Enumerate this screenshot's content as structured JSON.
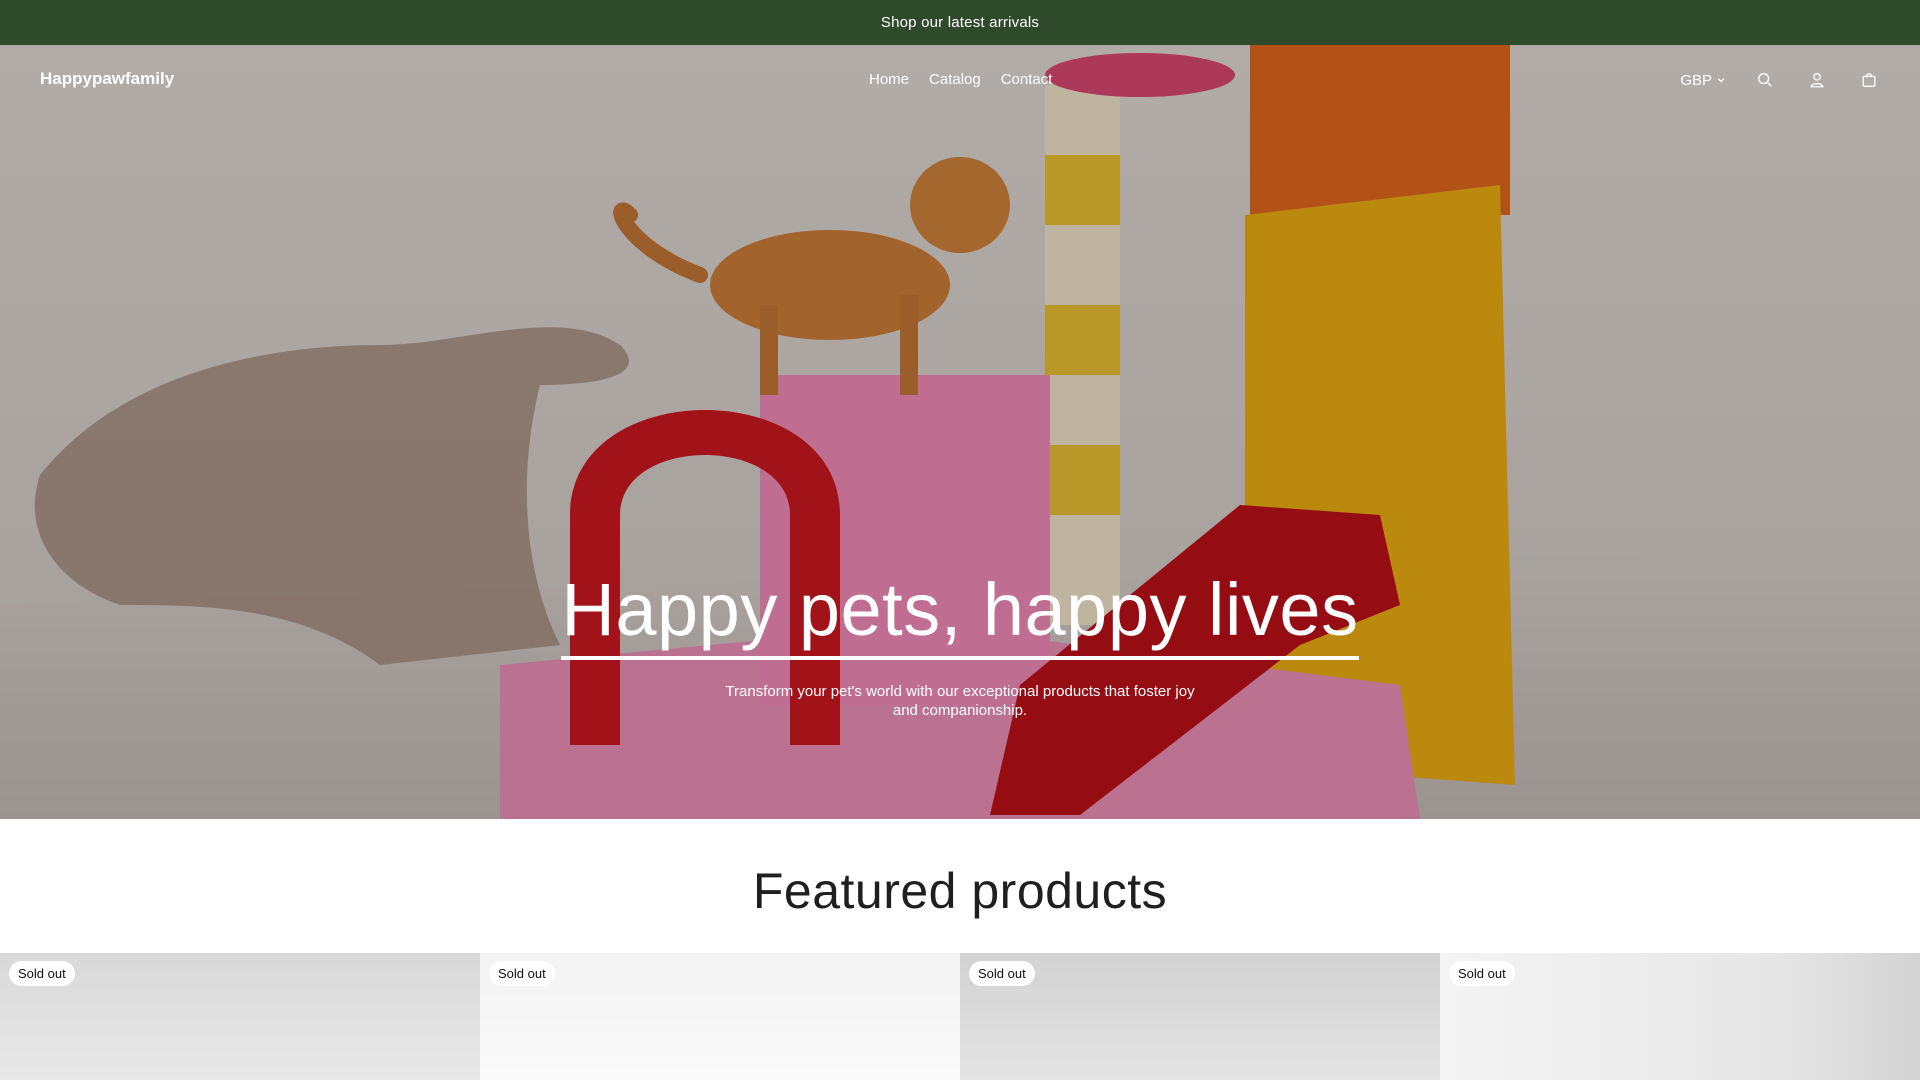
{
  "announcement": {
    "text": "Shop our latest arrivals"
  },
  "header": {
    "brand": "Happypawfamily",
    "nav": [
      {
        "label": "Home"
      },
      {
        "label": "Catalog"
      },
      {
        "label": "Contact"
      }
    ],
    "currency": "GBP",
    "icons": [
      "search-icon",
      "account-icon",
      "cart-icon"
    ]
  },
  "hero": {
    "title": "Happy pets, happy lives",
    "subtitle": "Transform your pet's world with our exceptional products that foster joy and companionship."
  },
  "featured": {
    "title": "Featured products",
    "products": [
      {
        "badge": "Sold out"
      },
      {
        "badge": "Sold out"
      },
      {
        "badge": "Sold out"
      },
      {
        "badge": "Sold out"
      }
    ]
  },
  "colors": {
    "announcement_bg": "#2e4a2b",
    "text_on_dark": "#ffffff"
  }
}
